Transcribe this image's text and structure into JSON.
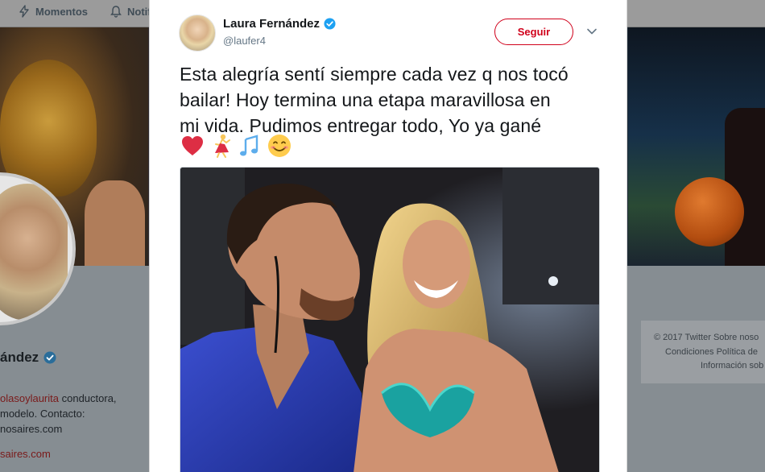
{
  "topnav": {
    "moments_label": "Momentos",
    "notifications_label": "Notif",
    "moments_icon": "lightning-icon",
    "notifications_icon": "bell-icon"
  },
  "profile": {
    "name_fragment": "ández",
    "bio_lines": [
      {
        "link": "olasoylaurita",
        "text": " conductora,"
      },
      {
        "link": "",
        "text": "modelo. Contacto:"
      },
      {
        "link": "",
        "text": "nosaires.com"
      },
      {
        "link": "saires.com",
        "text": ""
      }
    ]
  },
  "footer": {
    "line1": "© 2017 Twitter   Sobre noso",
    "line2": "Condiciones   Política de",
    "line3": "Información sob"
  },
  "tweet": {
    "author_name": "Laura Fernández",
    "author_handle": "@laufer4",
    "follow_label": "Seguir",
    "text_lines": [
      "Esta alegría sentí siempre cada vez q nos tocó",
      "bailar! Hoy termina una etapa maravillosa en",
      "mi vida. Pudimos entregar todo, Yo ya gané"
    ],
    "emojis": [
      "red-heart-icon",
      "dancer-icon",
      "musical-notes-icon",
      "smiling-face-icon"
    ],
    "accent_color": "#d0011b",
    "verified_color": "#1da1f2"
  }
}
